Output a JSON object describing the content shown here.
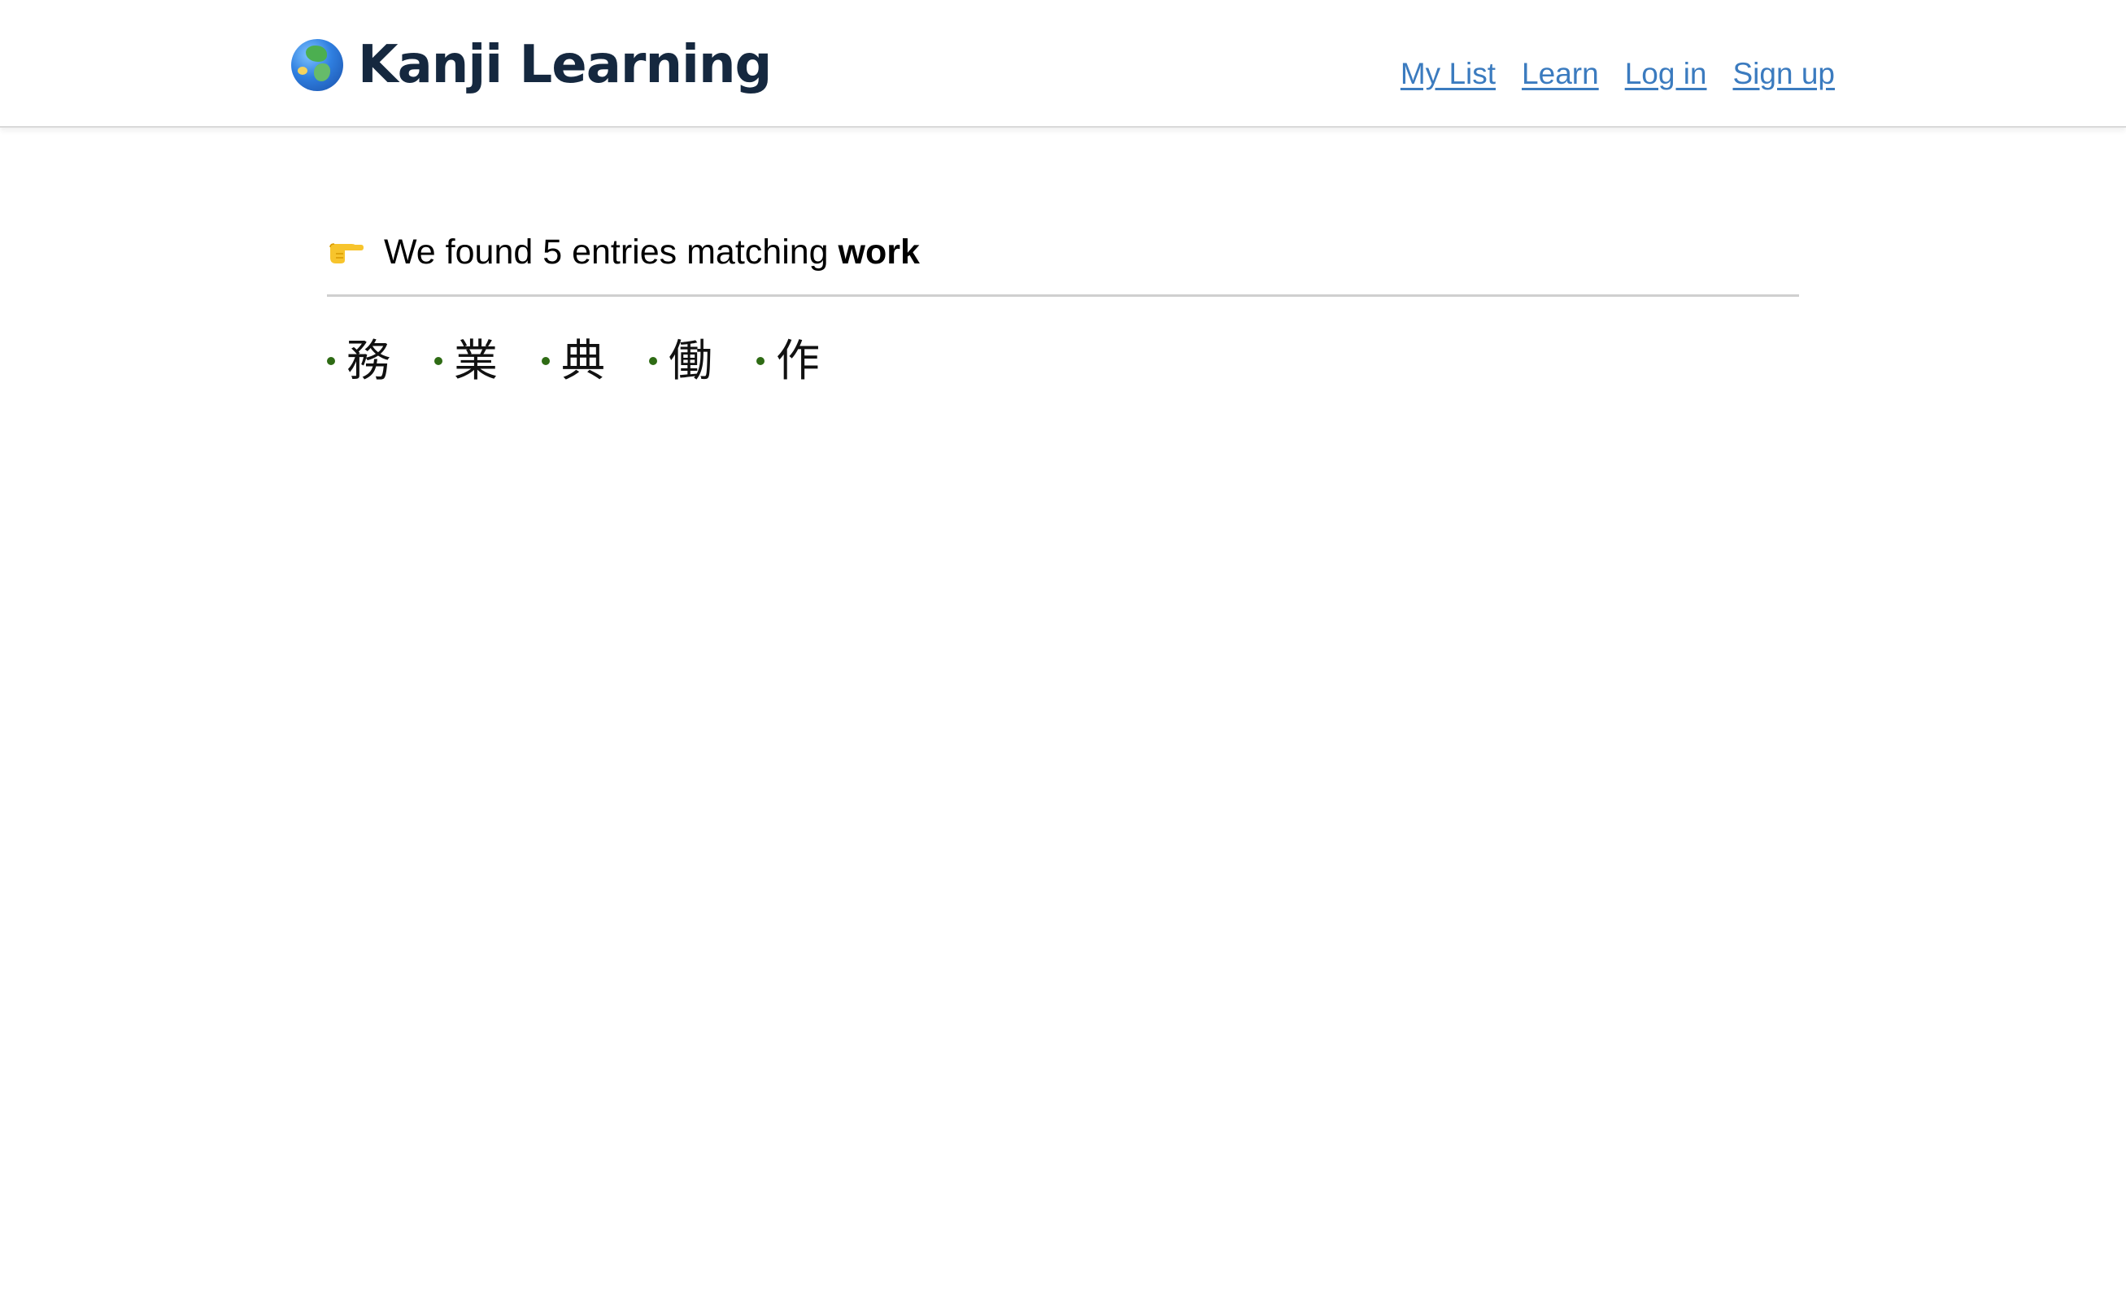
{
  "header": {
    "brand_title": "Kanji Learning",
    "brand_icon": "globe-asia-icon",
    "nav": [
      {
        "label": "My List"
      },
      {
        "label": "Learn"
      },
      {
        "label": "Log in"
      },
      {
        "label": "Sign up"
      }
    ],
    "link_color": "#3b7bbf",
    "brand_color": "#15283f"
  },
  "search": {
    "pointer_icon": "pointing-right-icon",
    "prefix": "We found 5 entries matching",
    "query": "work",
    "results": [
      {
        "kanji": "務"
      },
      {
        "kanji": "業"
      },
      {
        "kanji": "典"
      },
      {
        "kanji": "働"
      },
      {
        "kanji": "作"
      }
    ],
    "bullet_color": "#2e6b14"
  }
}
